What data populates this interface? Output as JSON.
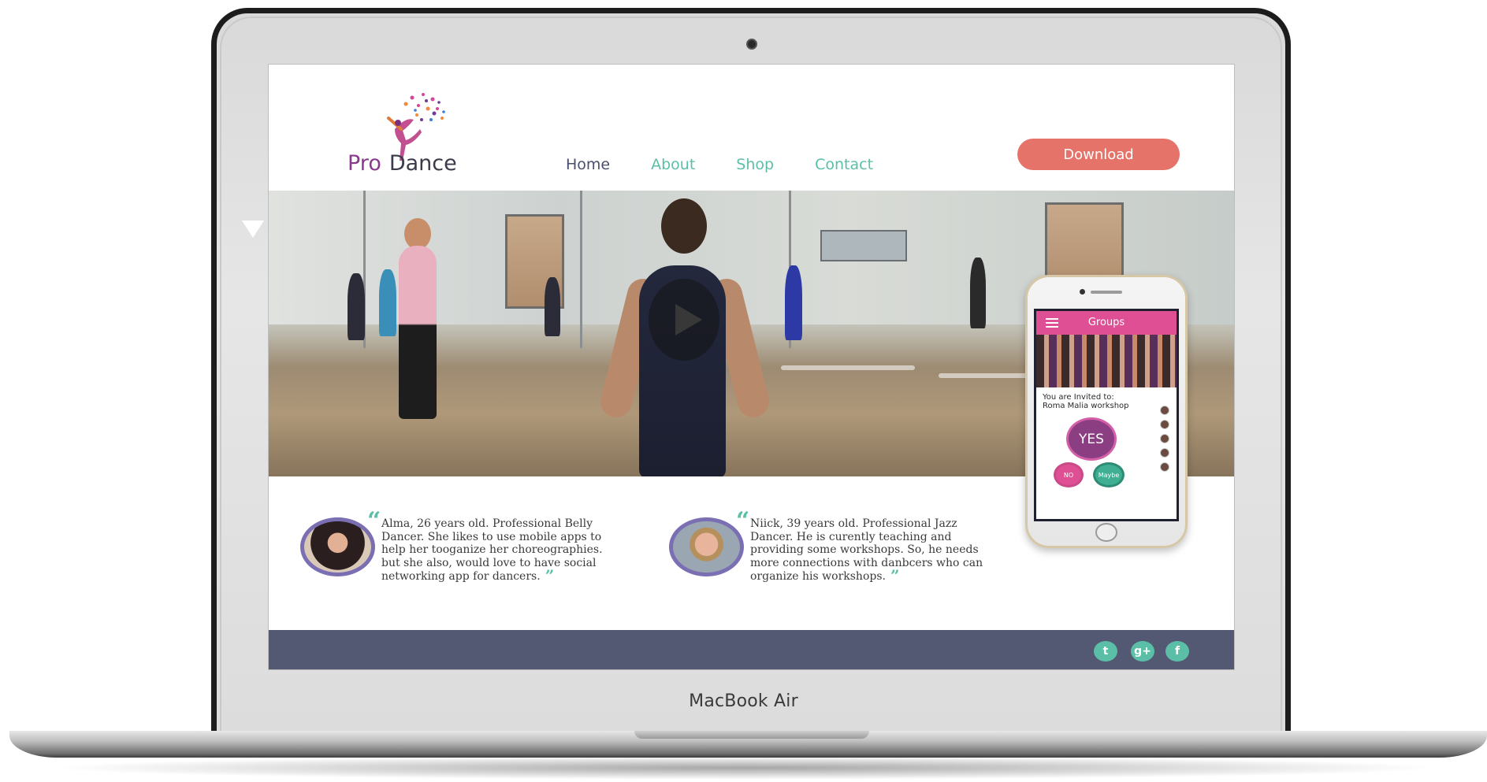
{
  "device": {
    "label": "MacBook Air"
  },
  "site": {
    "logo": {
      "word1": "Pro",
      "word2": "Dance"
    },
    "nav": [
      {
        "label": "Home",
        "active": true
      },
      {
        "label": "About",
        "active": false
      },
      {
        "label": "Shop",
        "active": false
      },
      {
        "label": "Contact",
        "active": false
      }
    ],
    "download_label": "Download",
    "testimonials": [
      {
        "text": "Alma, 26 years old. Professional Belly Dancer. She likes to use mobile apps to help her tooganize her choreographies. but she also, would love to have social networking app for dancers."
      },
      {
        "text": "Niick, 39 years old. Professional Jazz Dancer. He is curently teaching and providing some workshops. So, he needs more connections with danbcers who can organize his workshops."
      }
    ],
    "social": {
      "twitter": "t",
      "google_plus": "g+",
      "facebook": "f"
    }
  },
  "phone_app": {
    "title": "Groups",
    "invite_line1": "You are Invited to:",
    "invite_line2": "Roma Malia workshop",
    "yes_label": "YES",
    "no_label": "NO",
    "maybe_label": "Maybe"
  },
  "colors": {
    "accent_teal": "#5bbfa7",
    "nav_active": "#4b4f6e",
    "download_button": "#e67369",
    "footer": "#535873",
    "logo_purple": "#8a3a8c",
    "app_pink": "#de4f93"
  },
  "icons": [
    "play-icon",
    "twitter-icon",
    "google-plus-icon",
    "facebook-icon",
    "menu-icon",
    "quote-icon"
  ]
}
